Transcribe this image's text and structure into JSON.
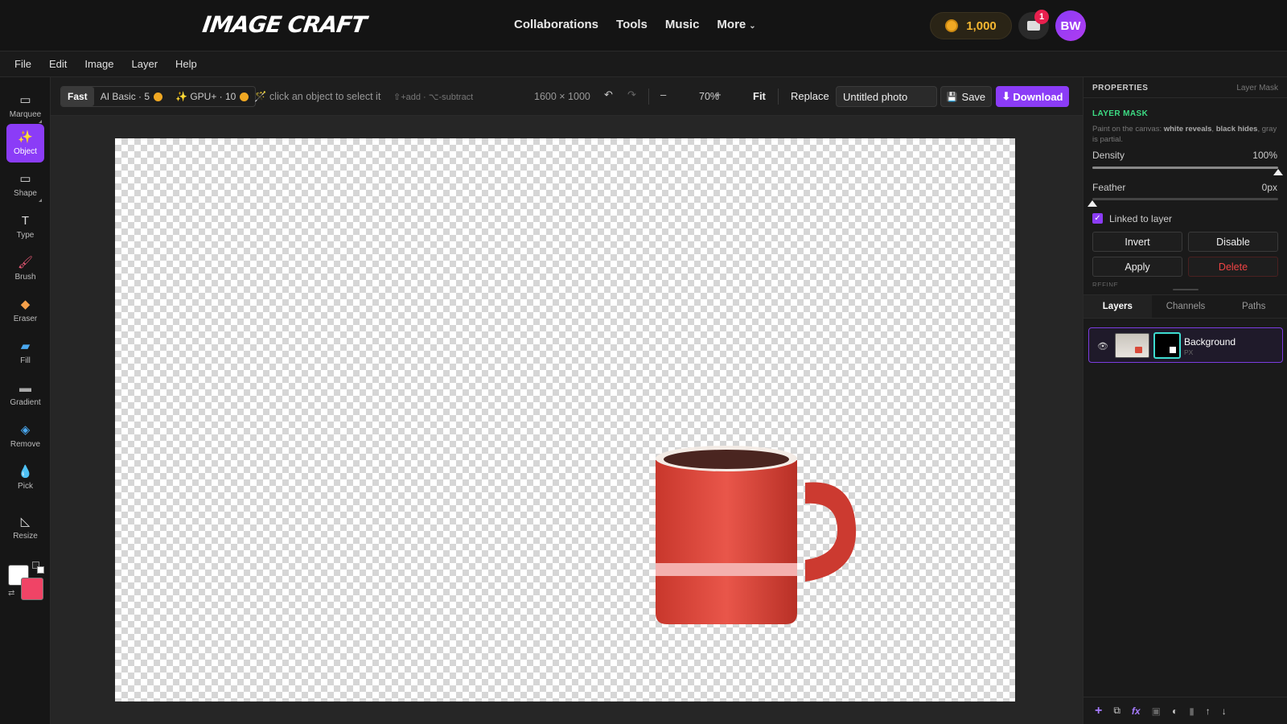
{
  "app": {
    "logo": "IMAGE CRAFT"
  },
  "nav": {
    "items": [
      "Collaborations",
      "Tools",
      "Music"
    ],
    "more": "More"
  },
  "account": {
    "coins": "1,000",
    "notifications": "1",
    "avatar": "BW"
  },
  "menu": [
    "File",
    "Edit",
    "Image",
    "Layer",
    "Help"
  ],
  "tools": [
    {
      "name": "marquee",
      "label": "Marquee",
      "icon": "▭"
    },
    {
      "name": "object",
      "label": "Object",
      "icon": "✨"
    },
    {
      "name": "shape",
      "label": "Shape",
      "icon": "▭"
    },
    {
      "name": "type",
      "label": "Type",
      "icon": "T"
    },
    {
      "name": "brush",
      "label": "Brush",
      "icon": "🖌"
    },
    {
      "name": "eraser",
      "label": "Eraser",
      "icon": "◆"
    },
    {
      "name": "fill",
      "label": "Fill",
      "icon": "▰"
    },
    {
      "name": "gradient",
      "label": "Gradient",
      "icon": "▬"
    },
    {
      "name": "remove",
      "label": "Remove",
      "icon": "◈"
    },
    {
      "name": "pick",
      "label": "Pick",
      "icon": "💧"
    },
    {
      "name": "resize",
      "label": "Resize",
      "icon": "◺"
    }
  ],
  "colors": {
    "foreground": "#ffffff",
    "background": "#f04466",
    "accent": "#8b3cf7"
  },
  "options": {
    "mode_fast": "Fast",
    "mode_ai_basic": "AI Basic · 5",
    "mode_gpu": "✨ GPU+ · 10",
    "hint": "🪄 click an object to select it",
    "hint_modifiers": "⇧+add · ⌥-subtract",
    "dims": "1600 × 1000",
    "zoom": "70%",
    "fit": "Fit",
    "replace": "Replace",
    "doc_name": "Untitled photo",
    "save": "Save",
    "download": "Download"
  },
  "properties": {
    "title": "PROPERTIES",
    "subtitle": "Layer Mask",
    "section": "LAYER MASK",
    "desc_prefix": "Paint on the canvas: ",
    "desc_white": "white reveals",
    "desc_mid": ", ",
    "desc_black": "black hides",
    "desc_suffix": ", gray is partial.",
    "density_label": "Density",
    "density_value": "100%",
    "density": 1.0,
    "feather_label": "Feather",
    "feather_value": "0px",
    "feather": 0.0,
    "linked_label": "Linked to layer",
    "invert": "Invert",
    "disable": "Disable",
    "apply": "Apply",
    "delete": "Delete",
    "refine": "REFINE"
  },
  "layers_panel": {
    "tabs": [
      "Layers",
      "Channels",
      "Paths"
    ],
    "layer_name": "Background",
    "layer_type": "PX"
  }
}
